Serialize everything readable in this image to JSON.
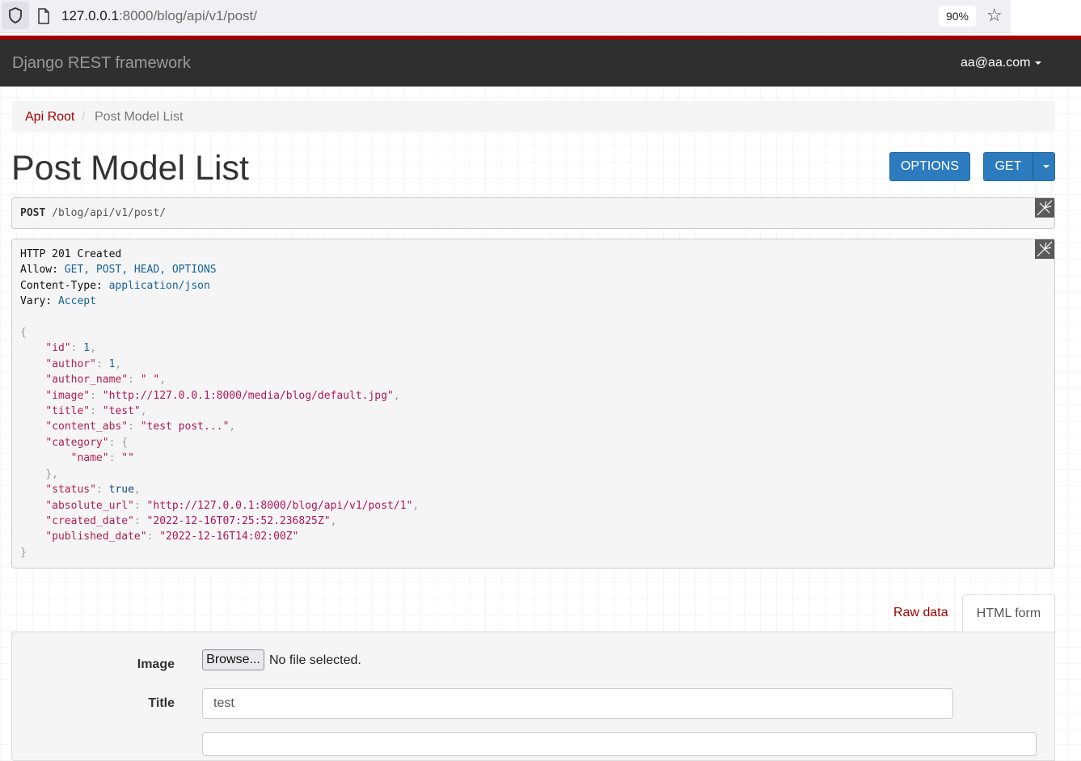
{
  "browser": {
    "url_host": "127.0.0.1",
    "url_rest": ":8000/blog/api/v1/post/",
    "zoom": "90%"
  },
  "navbar": {
    "brand": "Django REST framework",
    "user": "aa@aa.com"
  },
  "breadcrumb": {
    "root": "Api Root",
    "separator": "/",
    "current": "Post Model List"
  },
  "page": {
    "title": "Post Model List",
    "options_button": "OPTIONS",
    "get_button": "GET"
  },
  "request": {
    "method": "POST",
    "path": "/blog/api/v1/post/"
  },
  "response": {
    "status": "HTTP 201 Created",
    "headers": [
      {
        "key": "Allow",
        "value": "GET, POST, HEAD, OPTIONS"
      },
      {
        "key": "Content-Type",
        "value": "application/json"
      },
      {
        "key": "Vary",
        "value": "Accept"
      }
    ],
    "body": {
      "id": "1",
      "author": "1",
      "author_name": "\" \"",
      "image": "\"http://127.0.0.1:8000/media/blog/default.jpg\"",
      "title": "\"test\"",
      "content_abs": "\"test post...\"",
      "category_name": "\"\"",
      "status": "true",
      "absolute_url": "\"http://127.0.0.1:8000/blog/api/v1/post/1\"",
      "created_date": "\"2022-12-16T07:25:52.236825Z\"",
      "published_date": "\"2022-12-16T14:02:00Z\""
    }
  },
  "tabs": {
    "raw": "Raw data",
    "html": "HTML form"
  },
  "form": {
    "image_label": "Image",
    "browse_button": "Browse...",
    "file_status": "No file selected.",
    "title_label": "Title",
    "title_value": "test"
  },
  "colors": {
    "navbar_bg": "#2f2f2f",
    "accent": "#a30000",
    "button": "#2c7bbf"
  }
}
